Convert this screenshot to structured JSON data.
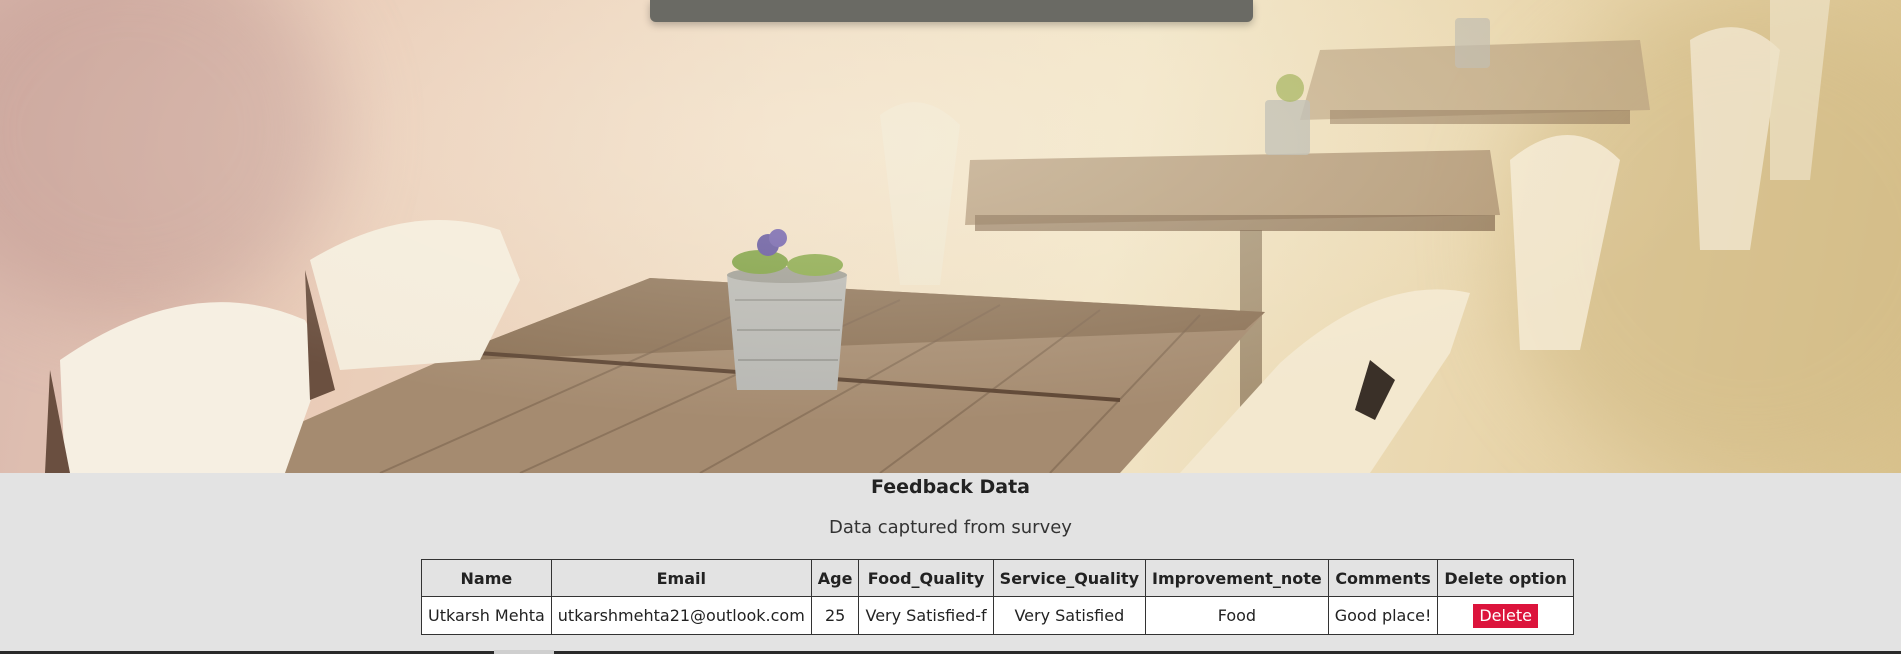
{
  "hero": {
    "image": "cafe-terrace-photo"
  },
  "section": {
    "title": "Feedback Data",
    "subtitle": "Data captured from survey"
  },
  "table": {
    "headers": [
      "Name",
      "Email",
      "Age",
      "Food_Quality",
      "Service_Quality",
      "Improvement_note",
      "Comments",
      "Delete option"
    ],
    "rows": [
      {
        "name": "Utkarsh Mehta",
        "email": "utkarshmehta21@outlook.com",
        "age": "25",
        "food_quality": "Very Satisfied-f",
        "service_quality": "Very Satisfied",
        "improvement_note": "Food",
        "comments": "Good place!",
        "delete_label": "Delete"
      }
    ]
  },
  "colors": {
    "delete_button": "#dc143c",
    "page_background": "#e3e3e3"
  }
}
